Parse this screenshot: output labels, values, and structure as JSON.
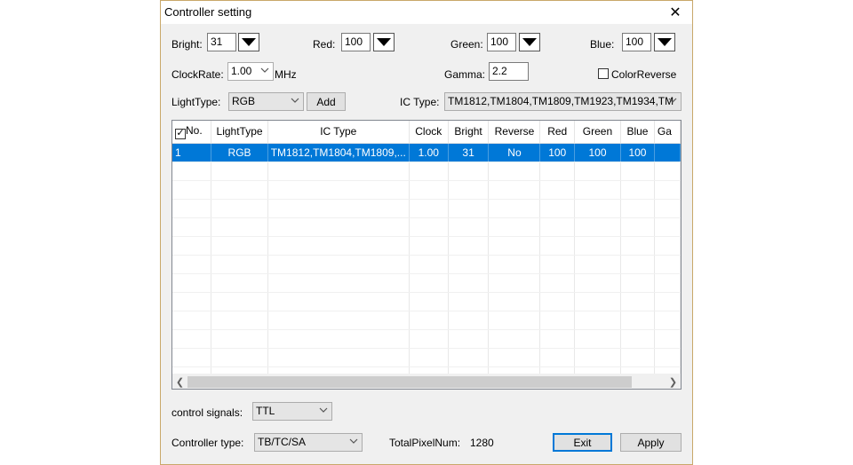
{
  "window": {
    "title": "Controller setting"
  },
  "row1": {
    "bright_label": "Bright:",
    "bright_value": "31",
    "red_label": "Red:",
    "red_value": "100",
    "green_label": "Green:",
    "green_value": "100",
    "blue_label": "Blue:",
    "blue_value": "100"
  },
  "row2": {
    "clockrate_label": "ClockRate:",
    "clockrate_value": "1.00",
    "mhz_label": "MHz",
    "gamma_label": "Gamma:",
    "gamma_value": "2.2",
    "colorreverse_label": "ColorReverse",
    "colorreverse_checked": false
  },
  "row3": {
    "lighttype_label": "LightType:",
    "lighttype_value": "RGB",
    "add_label": "Add",
    "ictype_label": "IC Type:",
    "ictype_value": "TM1812,TM1804,TM1809,TM1923,TM1934,TM"
  },
  "table": {
    "columns": [
      "No.",
      "LightType",
      "IC Type",
      "Clock",
      "Bright",
      "Reverse",
      "Red",
      "Green",
      "Blue",
      "Ga"
    ],
    "rows": [
      [
        "1",
        "RGB",
        "TM1812,TM1804,TM1809,...",
        "1.00",
        "31",
        "No",
        "100",
        "100",
        "100",
        ""
      ]
    ],
    "empty_rows": 12
  },
  "bottom": {
    "control_signals_label": "control signals:",
    "control_signals_value": "TTL",
    "controller_type_label": "Controller type:",
    "controller_type_value": "TB/TC/SA",
    "total_pixel_label": "TotalPixelNum:",
    "total_pixel_value": "1280",
    "exit_label": "Exit",
    "apply_label": "Apply"
  },
  "colors": {
    "selection": "#0078d7",
    "frame": "#c9a86a"
  }
}
